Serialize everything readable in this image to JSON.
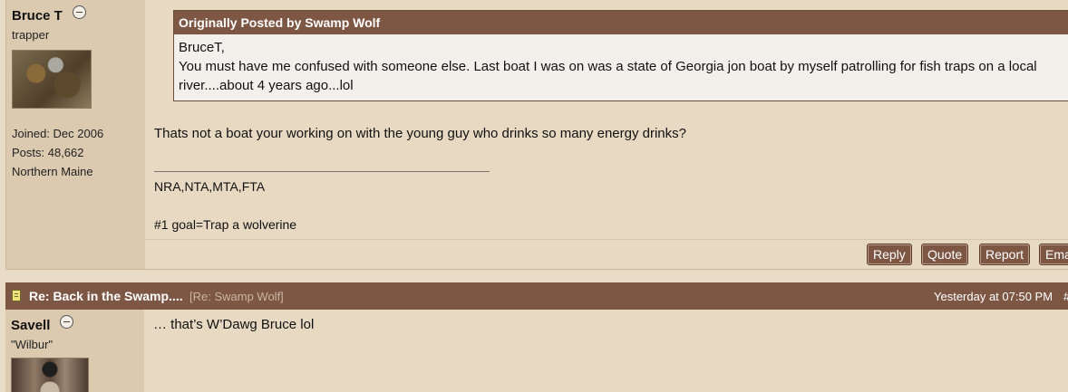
{
  "post1": {
    "author": {
      "name": "Bruce T",
      "title": "trapper",
      "joined": "Joined: Dec 2006",
      "posts": "Posts: 48,662",
      "location": "Northern Maine"
    },
    "quote": {
      "header": "Originally Posted by Swamp Wolf",
      "line1": "BruceT,",
      "line2": "You must have me confused with someone else. Last boat I was on was a state of Georgia jon boat by myself patrolling for fish traps on a local",
      "line3": "river....about 4 years ago...lol"
    },
    "message": "Thats not a boat your working on with the young guy who drinks so many energy drinks?",
    "signature": {
      "line1": "NRA,NTA,MTA,FTA",
      "line2": "#1 goal=Trap a wolverine"
    },
    "actions": {
      "reply": "Reply",
      "quote": "Quote",
      "report": "Report",
      "email": "Email"
    }
  },
  "post2": {
    "header": {
      "title": "Re: Back in the Swamp....",
      "re": "[Re: Swamp Wolf]",
      "timestamp": "Yesterday at 07:50 PM",
      "number": "#"
    },
    "author": {
      "name": "Savell",
      "title": "\"Wilbur\""
    },
    "message": "… that’s W’Dawg Bruce lol"
  },
  "colors": {
    "accent": "#7d5744",
    "sidebar": "#dccab0",
    "content": "#e8d9c3"
  }
}
